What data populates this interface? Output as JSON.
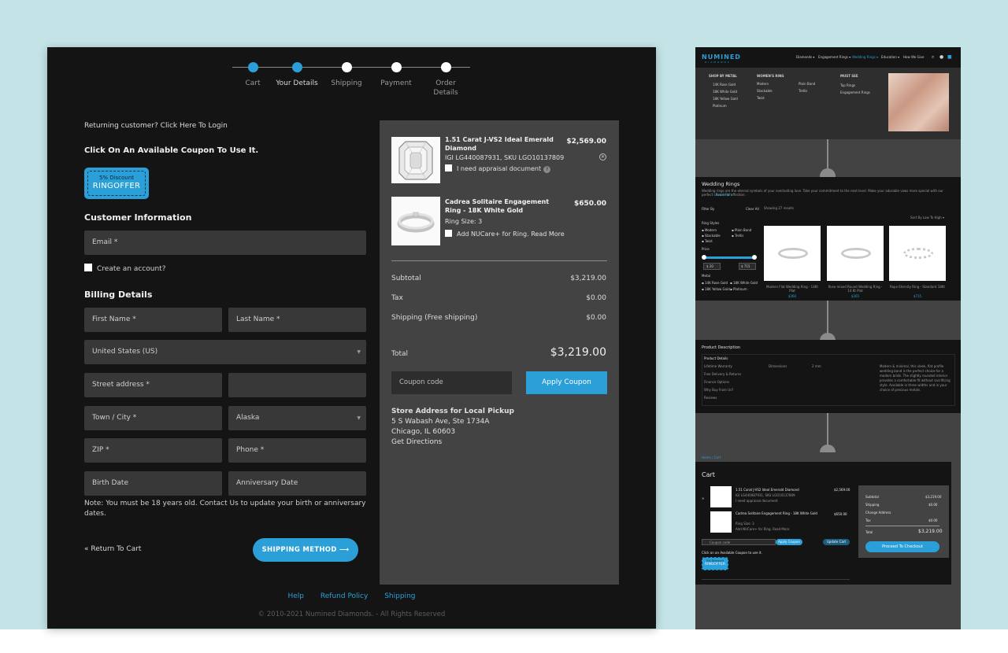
{
  "checkout": {
    "steps": [
      {
        "label": "Cart",
        "state": "active"
      },
      {
        "label": "Your Details",
        "state": "active"
      },
      {
        "label": "Shipping",
        "state": "done"
      },
      {
        "label": "Payment",
        "state": "done"
      },
      {
        "label": "Order Details",
        "state": "done"
      }
    ],
    "returning_text": "Returning customer? Click Here To Login",
    "coupon_heading": "Click On An Available Coupon To Use It.",
    "coupon_badge": {
      "discount": "5% Discount",
      "code": "RINGOFFER"
    },
    "customer_info_title": "Customer Information",
    "email_placeholder": "Email *",
    "create_account_label": "Create an account?",
    "billing_title": "Billing Details",
    "fields": {
      "first_name": "First Name *",
      "last_name": "Last Name *",
      "country": "United States (US)",
      "street": "Street address *",
      "street2": "",
      "town": "Town / City *",
      "state": "Alaska",
      "zip": "ZIP *",
      "phone": "Phone *",
      "birth": "Birth Date",
      "anniversary": "Anniversary Date"
    },
    "note": "Note: You must be 18 years old. Contact Us to update your birth or anniversary dates.",
    "return_to_cart": "« Return To Cart",
    "shipping_button": "SHIPPING METHOD ⟶",
    "summary": {
      "products": [
        {
          "title": "1.51 Carat J-VS2 Ideal Emerald Diamond",
          "sku": "IGI LG440087931, SKU LGO10137809",
          "option": "I need appraisal document",
          "price": "$2,569.00"
        },
        {
          "title": "Cadrea Solitaire Engagement Ring - 18K White Gold",
          "sku": "Ring Size: 3",
          "option": "Add NUCare+ for Ring.",
          "option_link": "Read More",
          "price": "$650.00"
        }
      ],
      "subtotal_label": "Subtotal",
      "subtotal": "$3,219.00",
      "tax_label": "Tax",
      "tax": "$0.00",
      "shipping_label": "Shipping (Free shipping)",
      "shipping": "$0.00",
      "total_label": "Total",
      "total": "$3,219.00",
      "coupon_placeholder": "Coupon code",
      "apply_label": "Apply Coupon",
      "store_heading": "Store Address for Local Pickup",
      "store_line1": "5 S Wabash Ave, Ste 1734A",
      "store_line2": "Chicago, IL 60603",
      "store_directions": "Get Directions"
    },
    "footer_links": [
      "Help",
      "Refund Policy",
      "Shipping"
    ],
    "copyright": "© 2010-2021 Numined Diamonds. - All Rights Reserved"
  },
  "preview": {
    "logo": "NUMINED",
    "logo_sub": "DIAMONDS",
    "nav": [
      "Diamonds ▾",
      "Engagement Rings ▾",
      "Wedding Rings ▾",
      "Education ▾",
      "How We Give"
    ],
    "mega": {
      "col1_title": "SHOP BY METAL",
      "col1": [
        "14K Rose Gold",
        "18K White Gold",
        "18K Yellow Gold",
        "Platinum"
      ],
      "col2_title": "WOMEN'S RING",
      "col2a": [
        "Modern",
        "Stackable",
        "Twist"
      ],
      "col2b": [
        "Plain Band",
        "Trellis"
      ],
      "col3_title": "MUST SEE",
      "col3": [
        "Top Rings",
        "Engagement Rings"
      ]
    },
    "wedding": {
      "title": "Wedding Rings",
      "desc": "Wedding rings are the eternal symbols of your everlasting love. Take your commitment to the next level. Make your adorable vows more special with our perfect choices of affection.",
      "read_more": "Read More",
      "filter_by": "Filter By",
      "clear_all": "Clear All",
      "showing": "Showing 27 results",
      "sort": "Sort By Low To High ▾",
      "ring_styles": "Ring Styles",
      "styles": [
        "Modern",
        "Stackable",
        "Twist"
      ],
      "styles_b": [
        "Plain Band",
        "Trellis"
      ],
      "price": "Price",
      "price_min": "$ 20",
      "price_max": "$ 715",
      "metal": "Metal",
      "metals": [
        "14K Rose Gold",
        "18K Yellow Gold"
      ],
      "metals_b": [
        "18K White Gold",
        "Platinum"
      ],
      "products": [
        {
          "name": "Modern Flat Wedding Ring - 14Kt Plat",
          "price": "$260"
        },
        {
          "name": "Rose mixed Round Wedding Ring - 14 Kt Plat",
          "price": "$265"
        },
        {
          "name": "Rope Eternity Ring - Standard 18Kt",
          "price": "$715"
        }
      ]
    },
    "description": {
      "title": "Product Description",
      "tabs": [
        "Product Details",
        "Lifetime Warranty",
        "Free Delivery & Returns",
        "Finance Options",
        "Why Buy From Us?",
        "Reviews"
      ],
      "dims_label": "Dimensions",
      "dims_value": "2 mm",
      "body": "Modern & minimal, this sleek, flat profile wedding band is the perfect choice for a modern bride. The slightly rounded interior provides a comfortable fit without sacrificing style. Available in three widths and in your choice of precious metals."
    },
    "cart": {
      "breadcrumb": "Home / Cart",
      "title": "Cart",
      "items": [
        {
          "name": "1.51 Carat J-VS2 Ideal Emerald Diamond",
          "sku": "IGI LG440087931, SKU LGO10137809",
          "opt": "I need appraisal document",
          "price": "$2,569.00"
        },
        {
          "name": "Cadrea Solitaire Engagement Ring - 18K White Gold",
          "sku": "Ring Size: 3",
          "opt": "Add NUCare+ for Ring. Read More",
          "price": "$650.00"
        }
      ],
      "coupon_placeholder": "Coupon code",
      "apply": "Apply Coupon",
      "update": "Update Cart",
      "coupon_hint": "Click on an Available Coupon to use it.",
      "badge_pct": "5% Discount",
      "badge_code": "RINGOFFER",
      "subtotal_label": "Subtotal",
      "subtotal": "$3,219.00",
      "shipping_label": "Shipping",
      "shipping": "$0.00",
      "change_address": "Change Address",
      "tax_label": "Tax",
      "tax": "$0.00",
      "total_label": "Total",
      "total": "$3,219.00",
      "checkout": "Proceed To Checkout"
    }
  }
}
